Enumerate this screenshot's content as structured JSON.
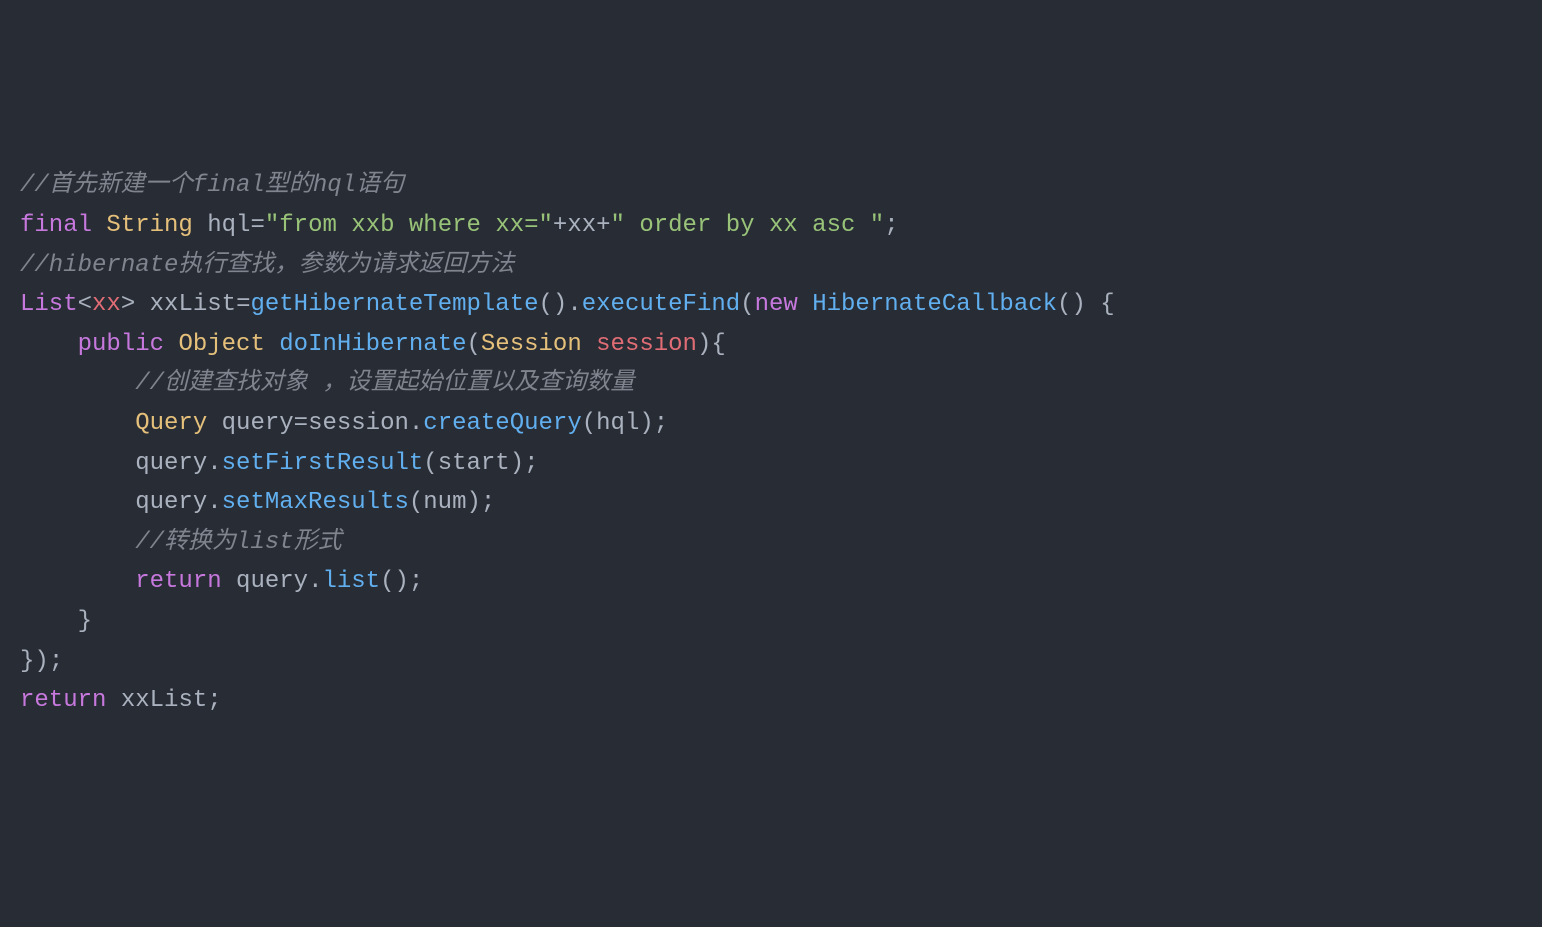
{
  "code": {
    "line1": {
      "comment": "//首先新建一个final型的hql语句"
    },
    "line2": {
      "kw_final": "final",
      "type_string": "String",
      "var_hql": "hql",
      "eq": "=",
      "str1": "\"from xxb where xx=\"",
      "plus1": "+",
      "var_xx": "xx",
      "plus2": "+",
      "str2": "\" order by xx asc \"",
      "semi": ";"
    },
    "line3": {
      "comment": "//hibernate执行查找，参数为请求返回方法"
    },
    "line4": {
      "type_list": "List",
      "lt": "<",
      "gen_xx": "xx",
      "gt": ">",
      "sp": " ",
      "var_xxlist": "xxList",
      "eq": "=",
      "m_getht": "getHibernateTemplate",
      "paren1": "()",
      "dot": ".",
      "m_execfind": "executeFind",
      "po": "(",
      "kw_new": "new",
      "sp2": " ",
      "cls_hcb": "HibernateCallback",
      "paren2": "()",
      "sp3": " ",
      "brace": "{"
    },
    "line5": {
      "indent": "    ",
      "kw_public": "public",
      "sp": " ",
      "type_obj": "Object",
      "sp2": " ",
      "m_doinhib": "doInHibernate",
      "po": "(",
      "type_session": "Session",
      "sp3": " ",
      "param_session": "session",
      "pc": ")",
      "brace": "{"
    },
    "line6": {
      "indent": "        ",
      "comment": "//创建查找对象 ，设置起始位置以及查询数量"
    },
    "line7": {
      "indent": "        ",
      "type_query": "Query",
      "sp": " ",
      "var_query": "query",
      "eq": "=",
      "var_session": "session",
      "dot": ".",
      "m_createquery": "createQuery",
      "po": "(",
      "arg_hql": "hql",
      "pc": ")",
      "semi": ";"
    },
    "line8": {
      "indent": "        ",
      "var_query": "query",
      "dot": ".",
      "m_setfirst": "setFirstResult",
      "po": "(",
      "arg_start": "start",
      "pc": ")",
      "semi": ";"
    },
    "line9": {
      "indent": "        ",
      "var_query": "query",
      "dot": ".",
      "m_setmax": "setMaxResults",
      "po": "(",
      "arg_num": "num",
      "pc": ")",
      "semi": ";"
    },
    "line10": {
      "indent": "        ",
      "comment": "//转换为list形式"
    },
    "line11": {
      "indent": "        ",
      "kw_return": "return",
      "sp": " ",
      "var_query": "query",
      "dot": ".",
      "m_list": "list",
      "paren": "()",
      "semi": ";"
    },
    "line12": {
      "indent": "    ",
      "brace": "}"
    },
    "line13": {
      "brace": "})",
      "semi": ";"
    },
    "line14": {
      "kw_return": "return",
      "sp": " ",
      "var_xxlist": "xxList",
      "semi": ";"
    }
  }
}
